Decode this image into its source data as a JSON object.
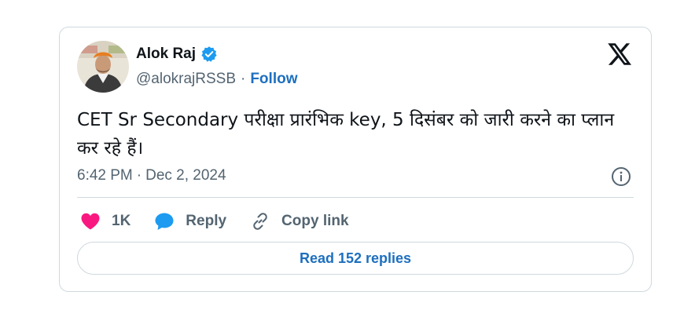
{
  "author": {
    "display_name": "Alok Raj",
    "handle": "@alokrajRSSB",
    "separator": "·",
    "follow_label": "Follow",
    "verified_icon": "verified-badge-icon",
    "avatar": "profile-photo"
  },
  "tweet": {
    "text": "CET Sr Secondary परीक्षा प्रारंभिक key, 5 दिसंबर को जारी करने का प्लान कर रहे हैं।",
    "time": "6:42 PM",
    "meta_separator": "·",
    "date": "Dec 2, 2024"
  },
  "actions": {
    "like_count": "1K",
    "reply_label": "Reply",
    "copy_link_label": "Copy link"
  },
  "footer": {
    "read_replies_label": "Read 152 replies"
  },
  "colors": {
    "accent": "#1d9bf0",
    "link": "#1d6fbf",
    "like": "#f91880",
    "muted": "#536471",
    "border": "#cfd9de"
  },
  "icons": {
    "brand": "x-logo-icon",
    "info": "info-icon",
    "like": "heart-icon",
    "reply": "reply-bubble-icon",
    "copy_link": "link-icon"
  }
}
